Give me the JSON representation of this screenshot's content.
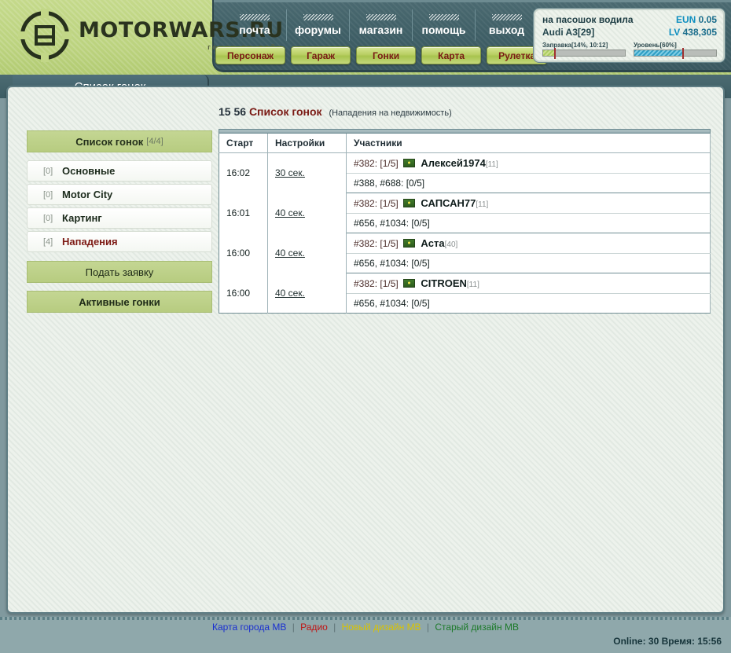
{
  "header": {
    "logo": {
      "title": "MOTORWARS.RU",
      "subtitle": "гонки он-лайн",
      "icon": "motorwars-logo-icon"
    },
    "toplinks": [
      {
        "label": "почта"
      },
      {
        "label": "форумы"
      },
      {
        "label": "магазин"
      },
      {
        "label": "помощь"
      },
      {
        "label": "выход"
      }
    ],
    "tabbuttons": [
      {
        "label": "Персонаж"
      },
      {
        "label": "Гараж"
      },
      {
        "label": "Гонки"
      },
      {
        "label": "Карта"
      },
      {
        "label": "Рулетка"
      }
    ],
    "user": {
      "name": "на пасошок водила",
      "car": "Audi A3[29]",
      "currency_label": "EUN",
      "currency_value": "0.05",
      "lv_label": "LV",
      "lv_value": "438,305",
      "fuel_label": "Заправка[14%, 10:12]",
      "fuel_percent": 14,
      "level_label": "Уровень[60%]",
      "level_percent": 60
    }
  },
  "section_tab": {
    "label": "Список гонок"
  },
  "sidebar": {
    "header": {
      "label": "Список гонок",
      "count": "[4/4]"
    },
    "items": [
      {
        "index": "[0]",
        "label": "Основные",
        "alert": false
      },
      {
        "index": "[0]",
        "label": "Motor City",
        "alert": false
      },
      {
        "index": "[0]",
        "label": "Картинг",
        "alert": false
      },
      {
        "index": "[4]",
        "label": "Нападения",
        "alert": true
      }
    ],
    "actions": [
      {
        "label": "Подать заявку"
      },
      {
        "label": "Активные гонки"
      }
    ]
  },
  "main": {
    "clock": "15 56",
    "title": "Список гонок",
    "subtitle": "(Нападения на недвижимость)",
    "table": {
      "columns": [
        "Старт",
        "Настройки",
        "Участники"
      ],
      "rows": [
        {
          "start": "16:02",
          "settings": "30 сек.",
          "participant_line": "#382: [1/5]",
          "participant_name": "Алексей1974",
          "participant_level": "[11]",
          "second_line": "#388, #688: [0/5]"
        },
        {
          "start": "16:01",
          "settings": "40 сек.",
          "participant_line": "#382: [1/5]",
          "participant_name": "САПСАН77",
          "participant_level": "[11]",
          "second_line": "#656, #1034: [0/5]"
        },
        {
          "start": "16:00",
          "settings": "40 сек.",
          "participant_line": "#382: [1/5]",
          "participant_name": "Acтa",
          "participant_level": "[40]",
          "second_line": "#656, #1034: [0/5]"
        },
        {
          "start": "16:00",
          "settings": "40 сек.",
          "participant_line": "#382: [1/5]",
          "participant_name": "CITROEN",
          "participant_level": "[11]",
          "second_line": "#656, #1034: [0/5]"
        }
      ]
    }
  },
  "footer": {
    "links": [
      {
        "label": "Карта города МВ",
        "color": "#1a2fd0"
      },
      {
        "label": "Радио",
        "color": "#c01414"
      },
      {
        "label": "Новый дизайн МВ",
        "color": "#d9c300"
      },
      {
        "label": "Старый дизайн МВ",
        "color": "#1d7a2a"
      }
    ],
    "separator": "|",
    "status": "Online: 30  Время: 15:56"
  }
}
